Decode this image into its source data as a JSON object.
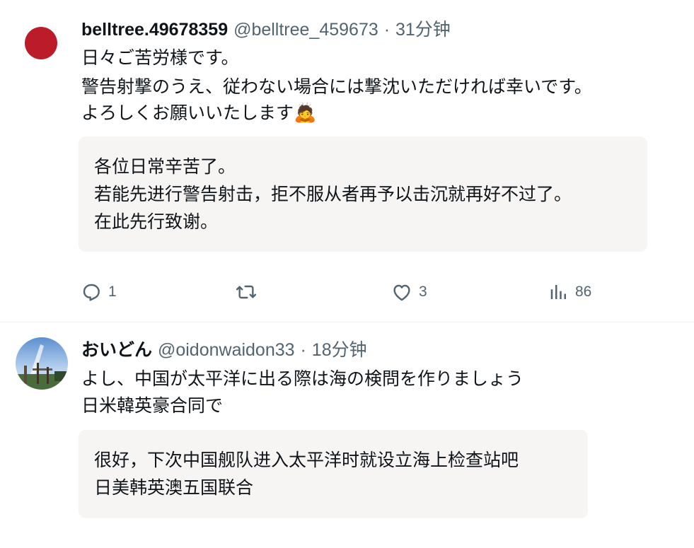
{
  "posts": [
    {
      "display_name": "belltree.49678359",
      "handle": "@belltree_459673",
      "separator": "·",
      "time": "31分钟",
      "text_lines": [
        "日々ご苦労様です。",
        "警告射撃のうえ、従わない場合には撃沈いただければ幸いです。",
        "よろしくお願いいたします"
      ],
      "emoji": "🙇",
      "translation_lines": [
        "各位日常辛苦了。",
        "若能先进行警告射击，拒不服从者再予以击沉就再好不过了。",
        "在此先行致谢。"
      ],
      "actions": {
        "reply_count": "1",
        "repost_count": "",
        "like_count": "3",
        "view_count": "86"
      },
      "avatar": "red-circle-flag"
    },
    {
      "display_name": "おいどん",
      "handle": "@oidonwaidon33",
      "separator": "·",
      "time": "18分钟",
      "text_lines": [
        "よし、中国が太平洋に出る際は海の検問を作りましょう",
        "日米韓英豪合同で"
      ],
      "translation_lines": [
        "很好，下次中国舰队进入太平洋时就设立海上检查站吧",
        "日美韩英澳五国联合"
      ],
      "avatar": "sky-photo"
    }
  ],
  "colors": {
    "text": "#0f1419",
    "secondary": "#536471",
    "translation_bg": "#f7f4f4",
    "divider": "#eff3f4",
    "flag_red": "#bc1c2a"
  }
}
